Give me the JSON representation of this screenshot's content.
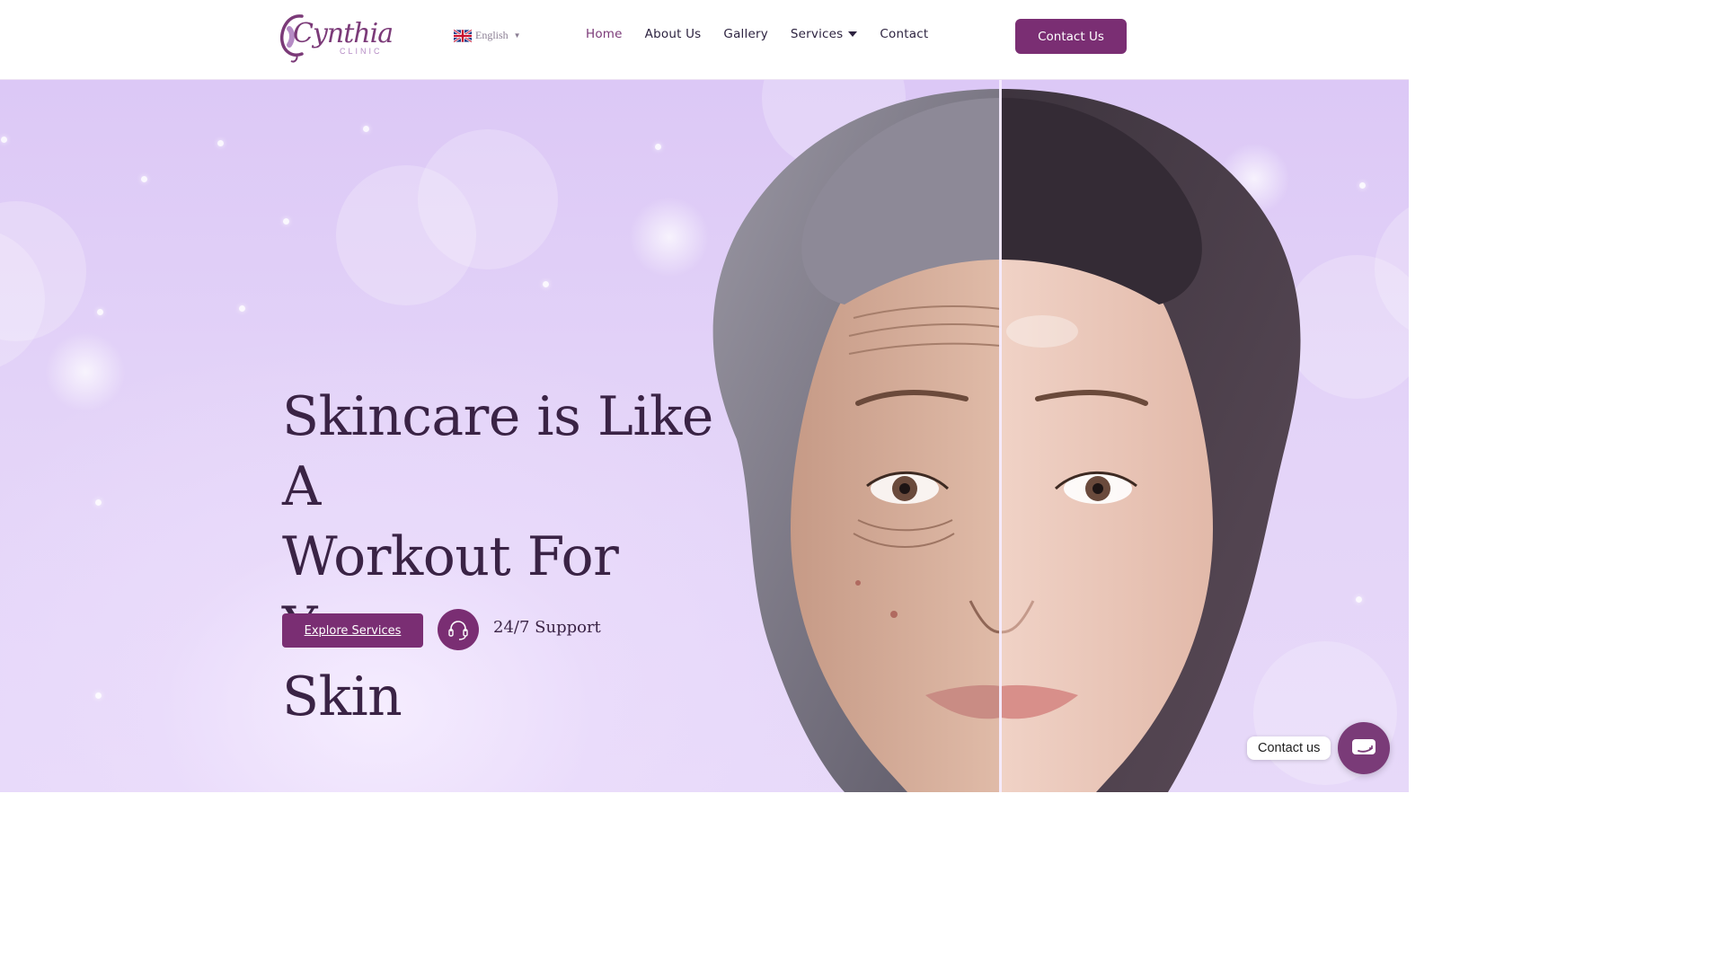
{
  "header": {
    "logo": {
      "script": "Cynthia",
      "sub": "CLINIC"
    },
    "language": {
      "label": "English",
      "flag": "uk-flag-icon"
    },
    "nav": [
      {
        "label": "Home",
        "active": true
      },
      {
        "label": "About Us"
      },
      {
        "label": "Gallery"
      },
      {
        "label": "Services",
        "has_dropdown": true
      },
      {
        "label": "Contact"
      }
    ],
    "cta_label": "Contact Us"
  },
  "hero": {
    "headline_lines": [
      "Skincare is Like A",
      "Workout For Your",
      "Skin"
    ],
    "explore_label": "Explore Services",
    "support_label": "24/7 Support",
    "support_icon": "headset-icon",
    "image": "before-after-face-comparison"
  },
  "floating_contact": {
    "label": "Contact us",
    "icon": "chat-icon"
  },
  "colors": {
    "brand": "#7a2e73",
    "text_dark": "#3a2345",
    "hero_bg": "#dcc8f6"
  }
}
